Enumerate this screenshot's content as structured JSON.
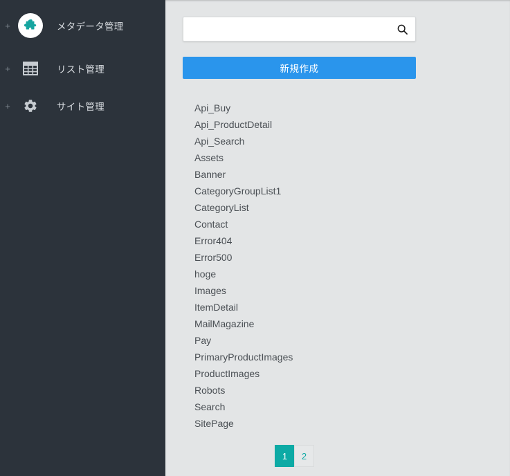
{
  "sidebar": {
    "items": [
      {
        "label": "メタデータ管理",
        "expander": "+",
        "icon": "puzzle-piece-icon",
        "active": true
      },
      {
        "label": "リスト管理",
        "expander": "+",
        "icon": "table-grid-icon",
        "active": false
      },
      {
        "label": "サイト管理",
        "expander": "+",
        "icon": "gear-icon",
        "active": false
      }
    ]
  },
  "search": {
    "value": "",
    "placeholder": "",
    "icon": "search-icon"
  },
  "toolbar": {
    "create_label": "新規作成"
  },
  "list": {
    "items": [
      "Api_Buy",
      "Api_ProductDetail",
      "Api_Search",
      "Assets",
      "Banner",
      "CategoryGroupList1",
      "CategoryList",
      "Contact",
      "Error404",
      "Error500",
      "hoge",
      "Images",
      "ItemDetail",
      "MailMagazine",
      "Pay",
      "PrimaryProductImages",
      "ProductImages",
      "Robots",
      "Search",
      "SitePage"
    ]
  },
  "pagination": {
    "pages": [
      {
        "label": "1",
        "active": true
      },
      {
        "label": "2",
        "active": false
      }
    ]
  },
  "colors": {
    "sidebar_bg": "#2c333b",
    "content_bg": "#e3e5e6",
    "accent_blue": "#2a95ec",
    "accent_teal": "#0daaa5",
    "icon_teal": "#16a5a0"
  }
}
